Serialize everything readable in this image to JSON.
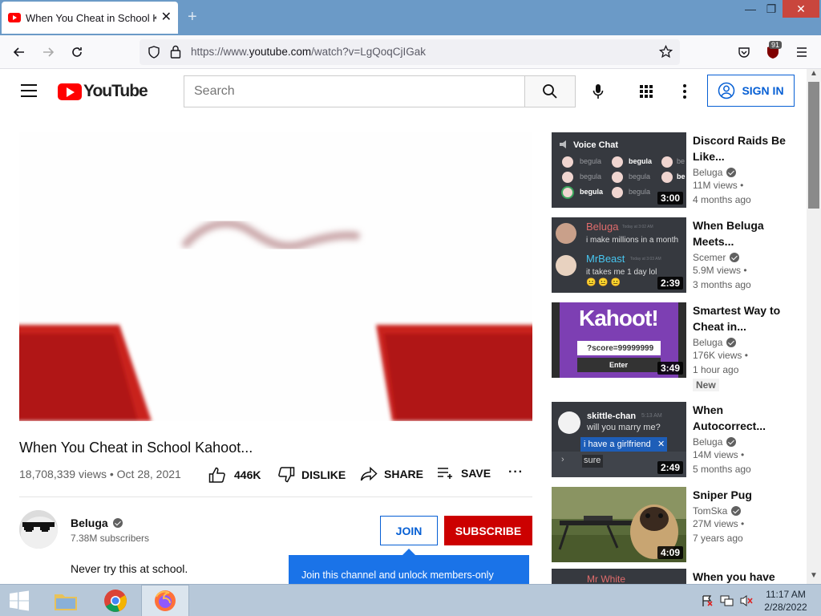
{
  "browser": {
    "tab_title": "When You Cheat in School Kahoot...",
    "new_tab": "+",
    "url_prefix": "https://www.",
    "url_domain": "youtube.com",
    "url_path": "/watch?v=LgQoqCjIGak",
    "extension_badge": "91"
  },
  "youtube": {
    "logo_text": "YouTube",
    "search_placeholder": "Search",
    "sign_in": "SIGN IN"
  },
  "video": {
    "title": "When You Cheat in School Kahoot...",
    "views": "18,708,339 views",
    "date": "Oct 28, 2021",
    "likes": "446K",
    "dislike_label": "DISLIKE",
    "share_label": "SHARE",
    "save_label": "SAVE",
    "more": "···"
  },
  "channel": {
    "name": "Beluga",
    "subscribers": "7.38M subscribers",
    "join_label": "JOIN",
    "subscribe_label": "SUBSCRIBE",
    "description": "Never try this at school.",
    "tooltip": "Join this channel and unlock members-only"
  },
  "related": [
    {
      "title": "Discord Raids Be Like...",
      "channel": "Beluga",
      "verified": true,
      "views": "11M views •",
      "age": "4 months ago",
      "duration": "3:00",
      "thumb": {
        "heading": "Voice Chat",
        "users": [
          "begula",
          "begula",
          "be",
          "begula",
          "begula",
          "be",
          "begula",
          "begula"
        ]
      }
    },
    {
      "title": "When Beluga Meets...",
      "channel": "Scemer",
      "verified": true,
      "views": "5.9M views •",
      "age": "3 months ago",
      "duration": "2:39",
      "thumb": {
        "user1": "Beluga",
        "time1": "Today at 3:02 AM",
        "msg1": "i make millions in a month",
        "user2": "MrBeast",
        "time2": "Today at 3:03 AM",
        "msg2": "it takes me 1 day lol",
        "emoji": "😐 😐 😐"
      }
    },
    {
      "title": "Smartest Way to Cheat in...",
      "channel": "Beluga",
      "verified": true,
      "views": "176K views •",
      "age": "1 hour ago",
      "badge": "New",
      "duration": "3:49",
      "thumb": {
        "brand": "Kahoot!",
        "field": "?score=99999999",
        "button": "Enter"
      }
    },
    {
      "title": "When Autocorrect...",
      "channel": "Beluga",
      "verified": true,
      "views": "14M views •",
      "age": "5 months ago",
      "duration": "2:49",
      "thumb": {
        "user": "skittle-chan",
        "time": "5:13 AM",
        "msg": "will you marry me?",
        "suggestion": "i have a girlfriend",
        "typed": "sure"
      }
    },
    {
      "title": "Sniper Pug",
      "channel": "TomSka",
      "verified": true,
      "views": "27M views •",
      "age": "7 years ago",
      "duration": "4:09"
    },
    {
      "title": "When you have",
      "thumb_text": "Mr White"
    }
  ],
  "taskbar": {
    "time": "11:17 AM",
    "date": "2/28/2022"
  },
  "colors": {
    "youtube_red": "#ff0000",
    "subscribe_red": "#cc0000",
    "link_blue": "#065fd4",
    "tooltip_blue": "#1a73e8"
  }
}
